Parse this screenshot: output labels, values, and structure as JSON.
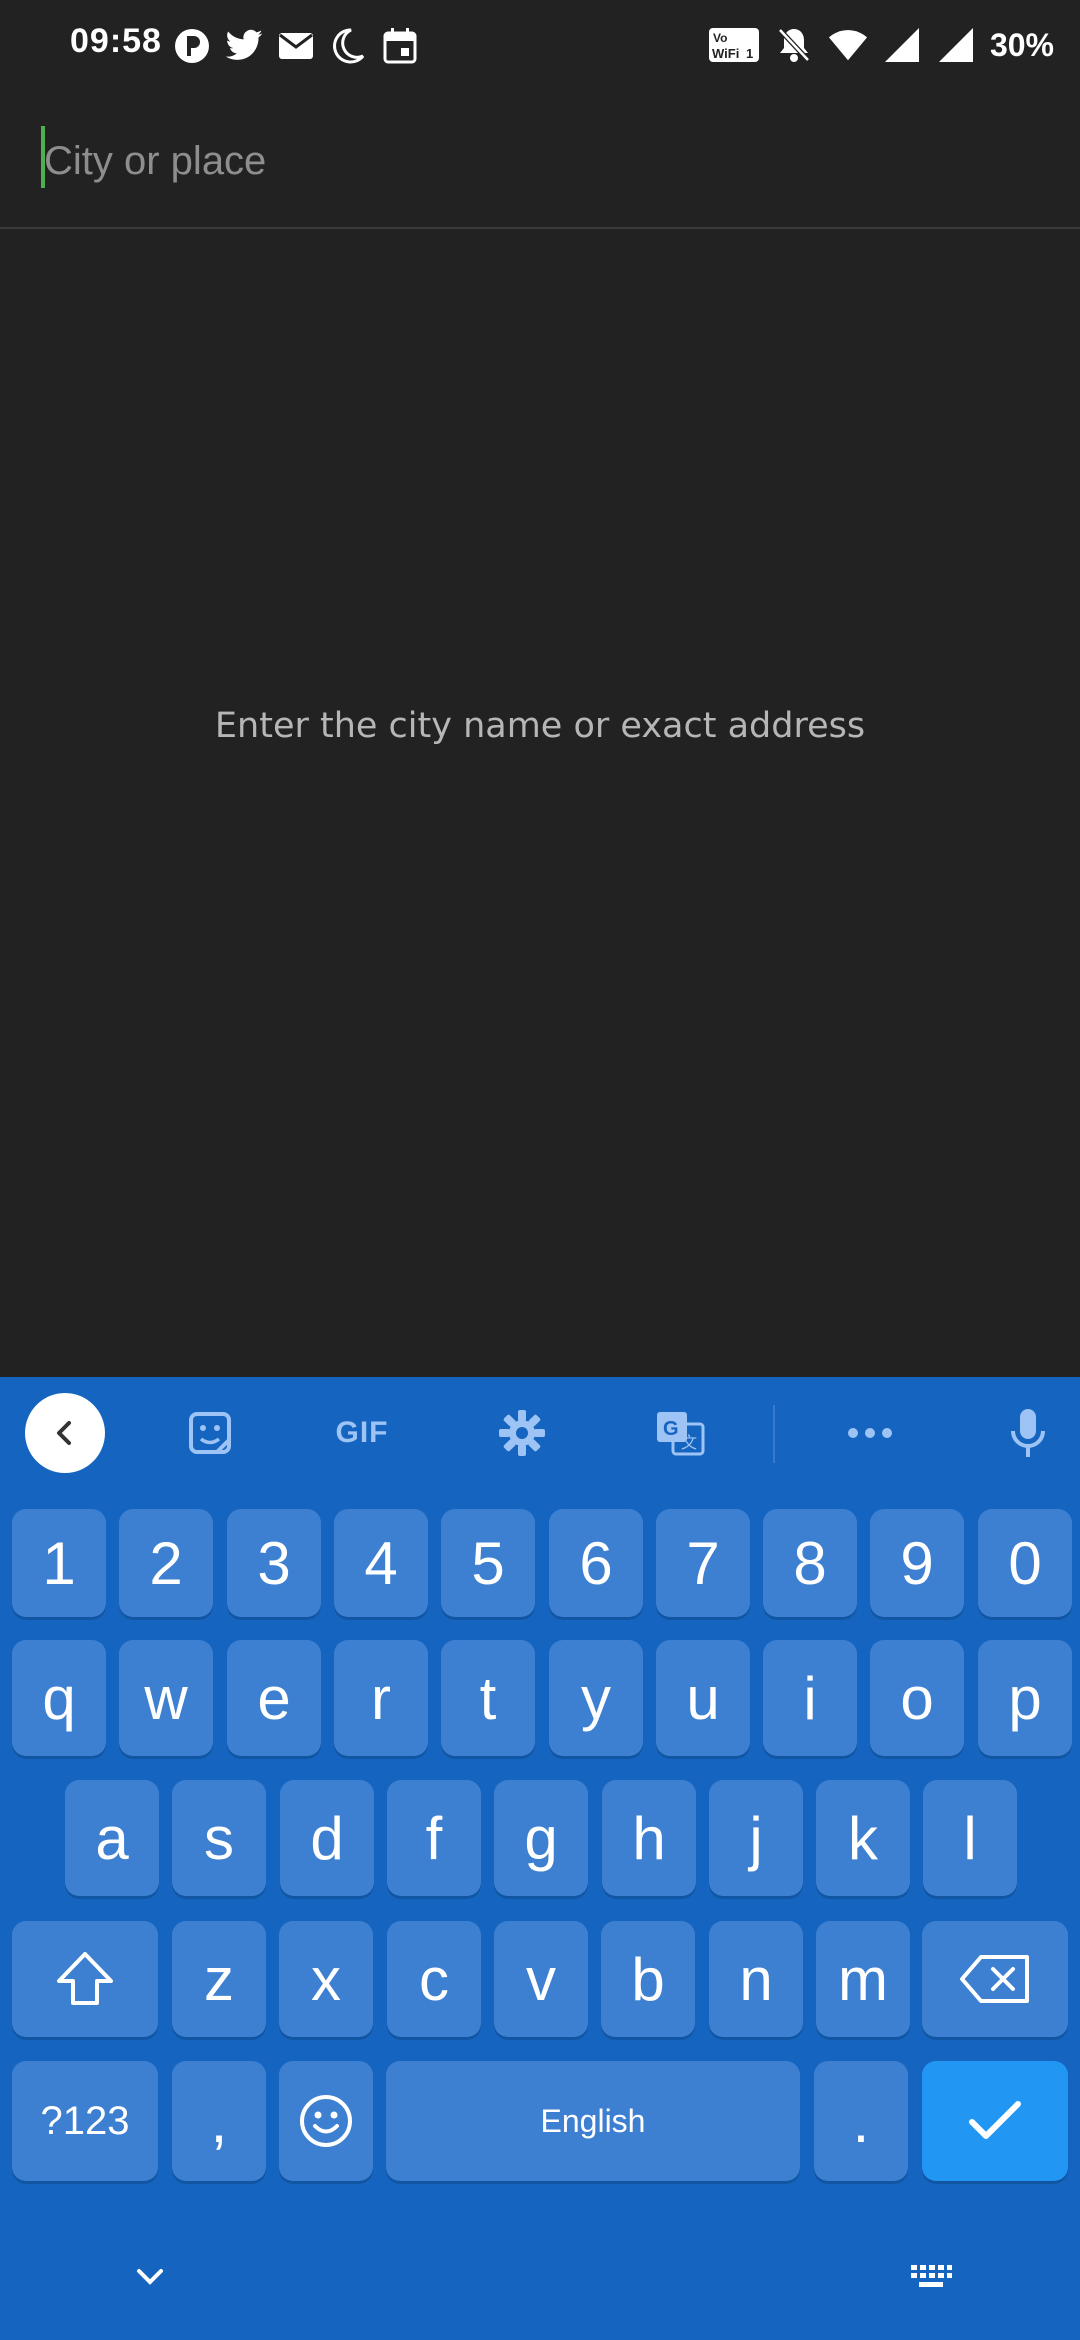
{
  "status_bar": {
    "time": "09:58",
    "battery": "30%",
    "left_icons": [
      "app-icon",
      "twitter-icon",
      "mail-icon",
      "moon-icon",
      "calendar-icon"
    ],
    "right_icons": [
      "vowifi-icon",
      "bell-off-icon",
      "wifi-icon",
      "signal-icon",
      "signal-icon"
    ]
  },
  "search": {
    "placeholder": "City or place",
    "value": ""
  },
  "hint": "Enter the city name or exact address",
  "keyboard": {
    "toolbar": {
      "gif_label": "GIF"
    },
    "number_row": [
      "1",
      "2",
      "3",
      "4",
      "5",
      "6",
      "7",
      "8",
      "9",
      "0"
    ],
    "row1": [
      "q",
      "w",
      "e",
      "r",
      "t",
      "y",
      "u",
      "i",
      "o",
      "p"
    ],
    "row2": [
      "a",
      "s",
      "d",
      "f",
      "g",
      "h",
      "j",
      "k",
      "l"
    ],
    "row3": [
      "z",
      "x",
      "c",
      "v",
      "b",
      "n",
      "m"
    ],
    "symbols_label": "?123",
    "comma_label": ",",
    "space_label": "English",
    "period_label": "."
  },
  "colors": {
    "background": "#222222",
    "keyboard": "#1565c0",
    "key": "#3d7fd0",
    "enter_key": "#2196f3",
    "caret": "#4caf50"
  }
}
